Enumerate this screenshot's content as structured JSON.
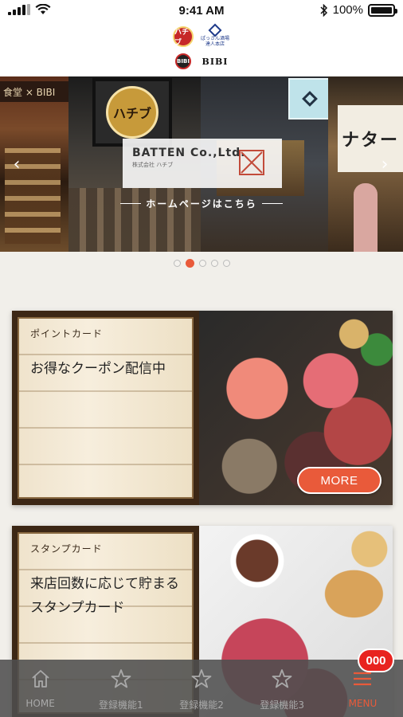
{
  "status_bar": {
    "time": "9:41 AM",
    "battery": "100%"
  },
  "header": {
    "logo_badge_1": "ハチブ",
    "logo_text_1": "ぱっさん酒場 達人本店",
    "logo_badge_2": "BIBI",
    "logo_bibi": "BIBI"
  },
  "banner": {
    "sign_text": "食堂 × BIBI",
    "medal_text": "ハチブ",
    "noren_text": "ナター",
    "company_title": "BATTEN Co.,Ltd.",
    "company_subtitle": "株式会社 ハチブ",
    "homepage_link": "ホームページはこちら",
    "pages": 5,
    "active_page": 1
  },
  "cards": [
    {
      "label": "ポイントカード",
      "title": "お得なクーポン配信中",
      "button": "MORE"
    },
    {
      "label": "スタンプカード",
      "title": "来店回数に応じて貯まるスタンプカード"
    }
  ],
  "tab_bar": {
    "items": [
      {
        "label": "HOME",
        "icon": "home-icon"
      },
      {
        "label": "登録機能1",
        "icon": "star-icon"
      },
      {
        "label": "登録機能2",
        "icon": "star-icon"
      },
      {
        "label": "登録機能3",
        "icon": "star-icon"
      },
      {
        "label": "MENU",
        "icon": "menu-icon"
      }
    ],
    "badge": "000"
  },
  "colors": {
    "accent": "#e95a3a",
    "tab_bar_bg": "#4e4e4e",
    "badge": "#e8231f"
  }
}
